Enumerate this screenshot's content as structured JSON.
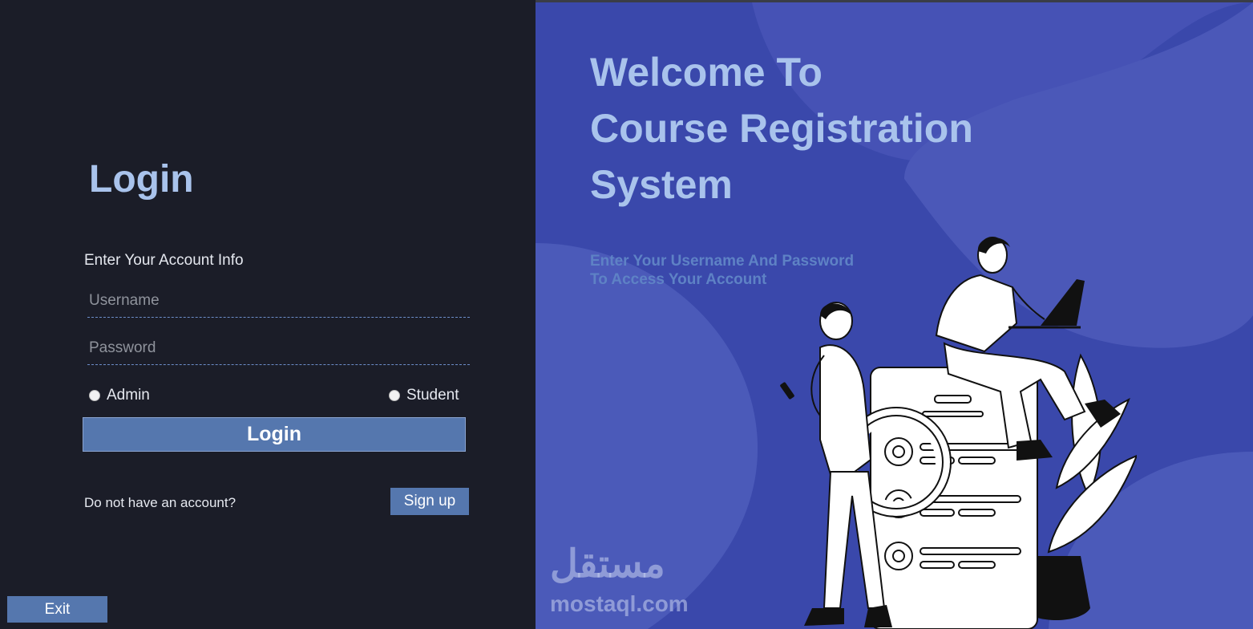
{
  "left": {
    "title": "Login",
    "account_info": "Enter Your Account Info",
    "username_placeholder": "Username",
    "password_placeholder": "Password",
    "roles": {
      "admin": "Admin",
      "student": "Student"
    },
    "login_button": "Login",
    "no_account_text": "Do not have an account?",
    "signup_button": "Sign up",
    "exit_button": "Exit"
  },
  "right": {
    "welcome_lines": [
      "Welcome To",
      "Course Registration",
      "System"
    ],
    "sub_lines": [
      "Enter Your Username And Password",
      "To Access Your Account"
    ],
    "watermark_ar": "مستقل",
    "watermark_en": "mostaql.com"
  },
  "colors": {
    "left_bg": "#1b1d28",
    "right_bg": "#3a48ab",
    "accent_button": "#5577ae",
    "title_color": "#a9c3ec"
  },
  "icons": [
    "radio-admin-icon",
    "radio-student-icon",
    "students-illustration"
  ]
}
